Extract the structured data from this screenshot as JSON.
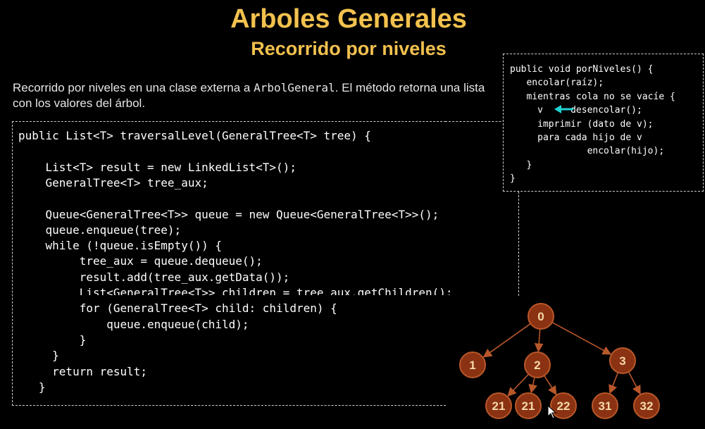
{
  "slide": {
    "title": "Arboles Generales",
    "subtitle": "Recorrido por niveles",
    "description_prefix": "Recorrido por niveles en una clase externa a ",
    "description_code": "ArbolGeneral",
    "description_suffix": ". El método retorna una lista con los valores del árbol."
  },
  "code": {
    "lines": [
      "public List<T> traversalLevel(GeneralTree<T> tree) {",
      "",
      "    List<T> result = new LinkedList<T>();",
      "    GeneralTree<T> tree_aux;",
      "",
      "    Queue<GeneralTree<T>> queue = new Queue<GeneralTree<T>>();",
      "    queue.enqueue(tree);",
      "    while (!queue.isEmpty()) {",
      "         tree_aux = queue.dequeue();",
      "         result.add(tree_aux.getData());",
      "         List<GeneralTree<T>> children = tree_aux.getChildren();",
      "         for (GeneralTree<T> child: children) {",
      "             queue.enqueue(child);",
      "         }",
      "     }",
      "     return result;",
      "   }"
    ],
    "bold_lines": [
      5,
      6,
      8,
      12
    ]
  },
  "pseudocode": {
    "lines": [
      "public void porNiveles() {",
      "   encolar(raíz);",
      "   mientras cola no se vacíe {",
      "     v     desencolar();",
      "     imprimir (dato de v);",
      "     para cada hijo de v",
      "              encolar(hijo);",
      "   }",
      "}"
    ]
  },
  "tree": {
    "nodes": [
      "0",
      "1",
      "2",
      "3",
      "21",
      "21",
      "22",
      "31",
      "32"
    ]
  },
  "colors": {
    "title": "#f2c14e",
    "node_fill": "#8a3212",
    "node_stroke": "#b8572a",
    "node_text": "#f5d9a8",
    "edge": "#b8572a",
    "arrow": "#22d3d3"
  },
  "icons": {
    "arrow": "left-arrow-icon",
    "cursor": "mouse-cursor-icon"
  }
}
